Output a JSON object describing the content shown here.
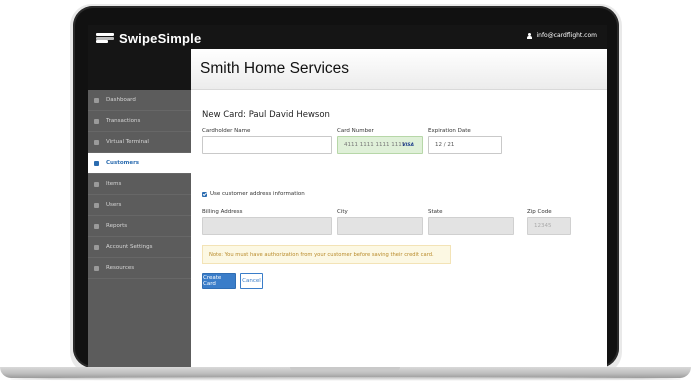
{
  "brand": {
    "name": "SwipeSimple"
  },
  "user": {
    "email": "info@cardflight.com"
  },
  "header": {
    "title": "Smith Home Services"
  },
  "sidebar": {
    "items": [
      {
        "label": "Dashboard",
        "icon": "dashboard-icon",
        "active": false
      },
      {
        "label": "Transactions",
        "icon": "transactions-icon",
        "active": false
      },
      {
        "label": "Virtual Terminal",
        "icon": "terminal-icon",
        "active": false
      },
      {
        "label": "Customers",
        "icon": "customers-icon",
        "active": true
      },
      {
        "label": "Items",
        "icon": "cart-icon",
        "active": false
      },
      {
        "label": "Users",
        "icon": "users-icon",
        "active": false
      },
      {
        "label": "Reports",
        "icon": "chart-icon",
        "active": false
      },
      {
        "label": "Account Settings",
        "icon": "gear-icon",
        "active": false
      },
      {
        "label": "Resources",
        "icon": "book-icon",
        "active": false
      }
    ]
  },
  "form": {
    "title": "New Card: Paul David Hewson",
    "cardholder_label": "Cardholder Name",
    "cardholder_value": "",
    "card_number_label": "Card Number",
    "card_number_value": "4111 1111 1111 1111",
    "card_brand": "VISA",
    "expiration_label": "Expiration Date",
    "expiration_value": "12 / 21",
    "use_address_label": "Use customer address information",
    "use_address_checked": true,
    "billing_label": "Billing Address",
    "city_label": "City",
    "state_label": "State",
    "zip_label": "Zip Code",
    "zip_placeholder": "12345",
    "note": "Note: You must have authorization from your customer before saving their credit card.",
    "create_button": "Create Card",
    "cancel_button": "Cancel"
  },
  "colors": {
    "accent": "#3a7dc9",
    "sidebar": "#5c5c5c",
    "topbar": "#151515",
    "success_field": "#dff0d8",
    "warning_bg": "#fcf8e3"
  }
}
